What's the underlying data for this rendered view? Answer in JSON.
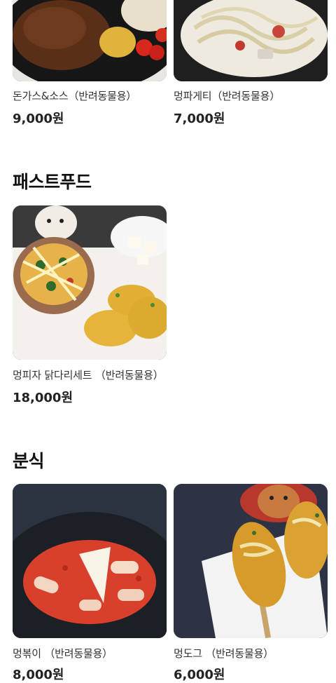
{
  "sections": [
    {
      "items": [
        {
          "name": "돈가스&소스（반려동물용）",
          "price": "9,000원",
          "image": "tonkatsu-plate"
        },
        {
          "name": "멍파게티（반려동물용）",
          "price": "7,000원",
          "image": "spaghetti-plate"
        }
      ]
    },
    {
      "title": "패스트푸드",
      "items": [
        {
          "name": "멍피자 닭다리세트 （반려동물용）",
          "price": "18,000원",
          "image": "pizza-chicken-set"
        }
      ]
    },
    {
      "title": "분식",
      "items": [
        {
          "name": "멍볶이 （반려동물용）",
          "price": "8,000원",
          "image": "tteokbokki-plate"
        },
        {
          "name": "멍도그 （반려동물용）",
          "price": "6,000원",
          "image": "corndog-plate"
        }
      ]
    }
  ]
}
